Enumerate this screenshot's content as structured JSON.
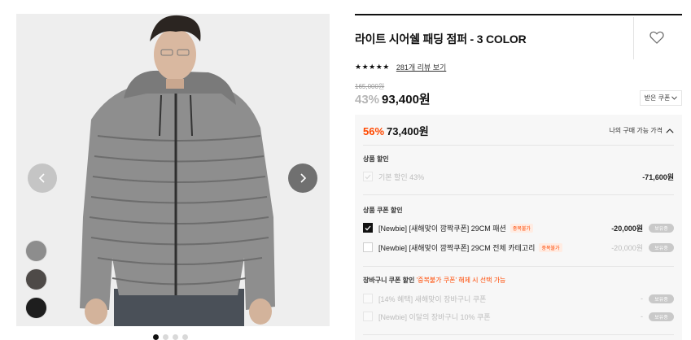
{
  "product": {
    "title": "라이트 시어쉘 패딩 점퍼 - 3 COLOR",
    "stars": "★★★★★",
    "reviews_link": "281개 리뷰 보기",
    "original_price": "165,000원",
    "discount_rate": "43%",
    "sale_price": "93,400원",
    "coupon_button": "받은 쿠폰"
  },
  "gallery": {
    "swatch_colors": [
      "#8d8d8d",
      "#4e4a48",
      "#1e1e1e"
    ],
    "dot_count": 4,
    "active_dot": 0
  },
  "benefit": {
    "rate": "56%",
    "price": "73,400원",
    "toggle_label": "나의 구매 가능 가격",
    "product_discount": {
      "title": "상품 할인",
      "item_label": "기본 할인 43%",
      "item_amount": "-71,600원"
    },
    "product_coupon": {
      "title": "상품 쿠폰 할인",
      "items": [
        {
          "label": "[Newbie] [새해맞이 깜짝쿠폰] 29CM 패션",
          "tag": "중복불가",
          "amount": "-20,000원",
          "pill": "보유중",
          "checked": true
        },
        {
          "label": "[Newbie] [새해맞이 깜짝쿠폰] 29CM 전체 카테고리",
          "tag": "중복불가",
          "amount": "-20,000원",
          "pill": "보유중",
          "checked": false
        }
      ]
    },
    "cart_coupon": {
      "title": "장바구니 쿠폰 할인",
      "note": "'중복불가 쿠폰' 해제 시 선택 가능",
      "items": [
        {
          "label": "[14% 혜택] 새해맞이 장바구니 쿠폰",
          "amount": "-",
          "pill": "보유중"
        },
        {
          "label": "[Newbie] 이달의 장바구니 10% 쿠폰",
          "amount": "-",
          "pill": "보유중"
        }
      ]
    }
  },
  "colors": {
    "accent": "#ff4800",
    "text": "#111111",
    "panel": "#f7f7f7"
  }
}
